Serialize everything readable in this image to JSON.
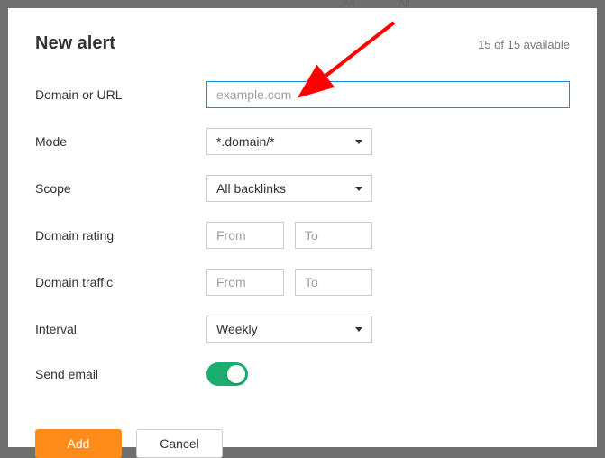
{
  "background": {
    "tab1": "All",
    "tab2": "All"
  },
  "header": {
    "title": "New alert",
    "available": "15 of 15 available"
  },
  "form": {
    "domain_label": "Domain or URL",
    "domain_placeholder": "example.com",
    "mode_label": "Mode",
    "mode_value": "*.domain/*",
    "scope_label": "Scope",
    "scope_value": "All backlinks",
    "rating_label": "Domain rating",
    "rating_from_placeholder": "From",
    "rating_to_placeholder": "To",
    "traffic_label": "Domain traffic",
    "traffic_from_placeholder": "From",
    "traffic_to_placeholder": "To",
    "interval_label": "Interval",
    "interval_value": "Weekly",
    "send_email_label": "Send email",
    "send_email_on": true
  },
  "footer": {
    "add_label": "Add",
    "cancel_label": "Cancel"
  },
  "colors": {
    "accent_orange": "#ff8c1a",
    "toggle_green": "#1aae6f",
    "focus_blue": "#1e88e5",
    "arrow_red": "#ff0000"
  }
}
